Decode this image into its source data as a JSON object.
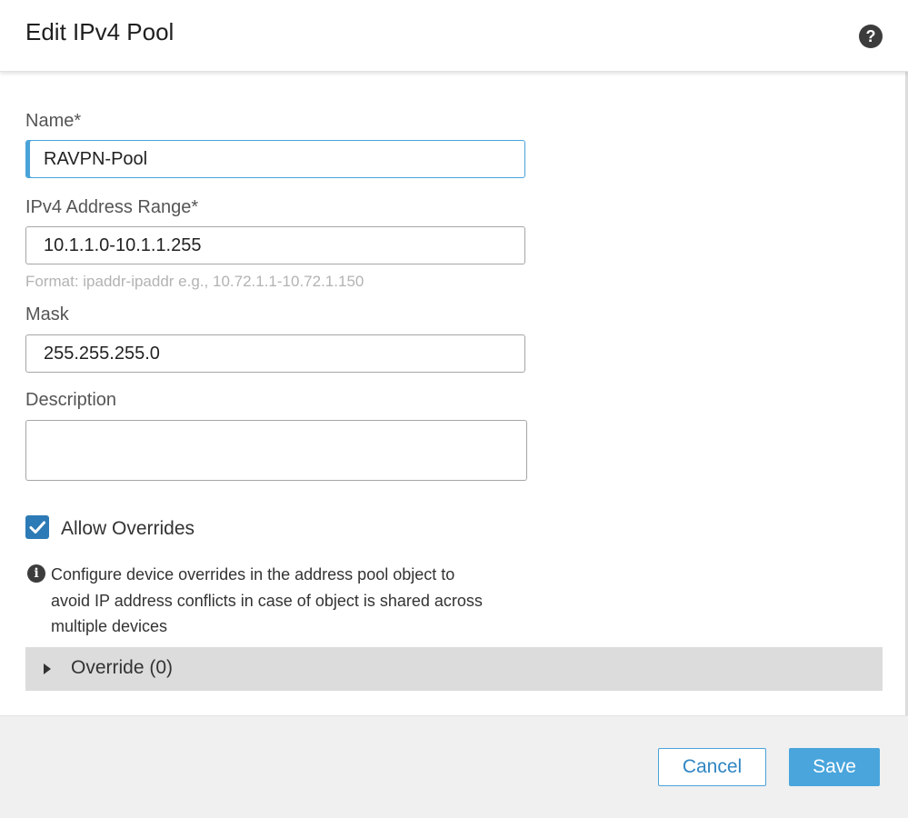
{
  "dialog": {
    "title": "Edit IPv4 Pool",
    "help_icon": "question-circle-icon",
    "help_glyph": "?"
  },
  "form": {
    "name": {
      "label": "Name*",
      "value": "RAVPN-Pool"
    },
    "range": {
      "label": "IPv4 Address Range*",
      "value": "10.1.1.0-10.1.1.255",
      "hint": "Format: ipaddr-ipaddr e.g., 10.72.1.1-10.72.1.150"
    },
    "mask": {
      "label": "Mask",
      "value": "255.255.255.0"
    },
    "description": {
      "label": "Description",
      "value": ""
    },
    "allow_overrides": {
      "label": "Allow Overrides",
      "checked": true
    },
    "info": {
      "icon": "info-circle-icon",
      "glyph": "i",
      "lines": [
        "Configure device overrides in the address pool object to",
        "avoid IP address conflicts in case of object is shared across",
        "multiple devices"
      ]
    },
    "override": {
      "label": "Override (0)",
      "icon": "caret-right-icon"
    }
  },
  "footer": {
    "cancel_label": "Cancel",
    "save_label": "Save"
  },
  "colors": {
    "accent": "#49a5dc",
    "checkbox": "#2d7bb6",
    "override_bar": "#dcdcdc",
    "footer_bg": "#f0f0f0"
  }
}
